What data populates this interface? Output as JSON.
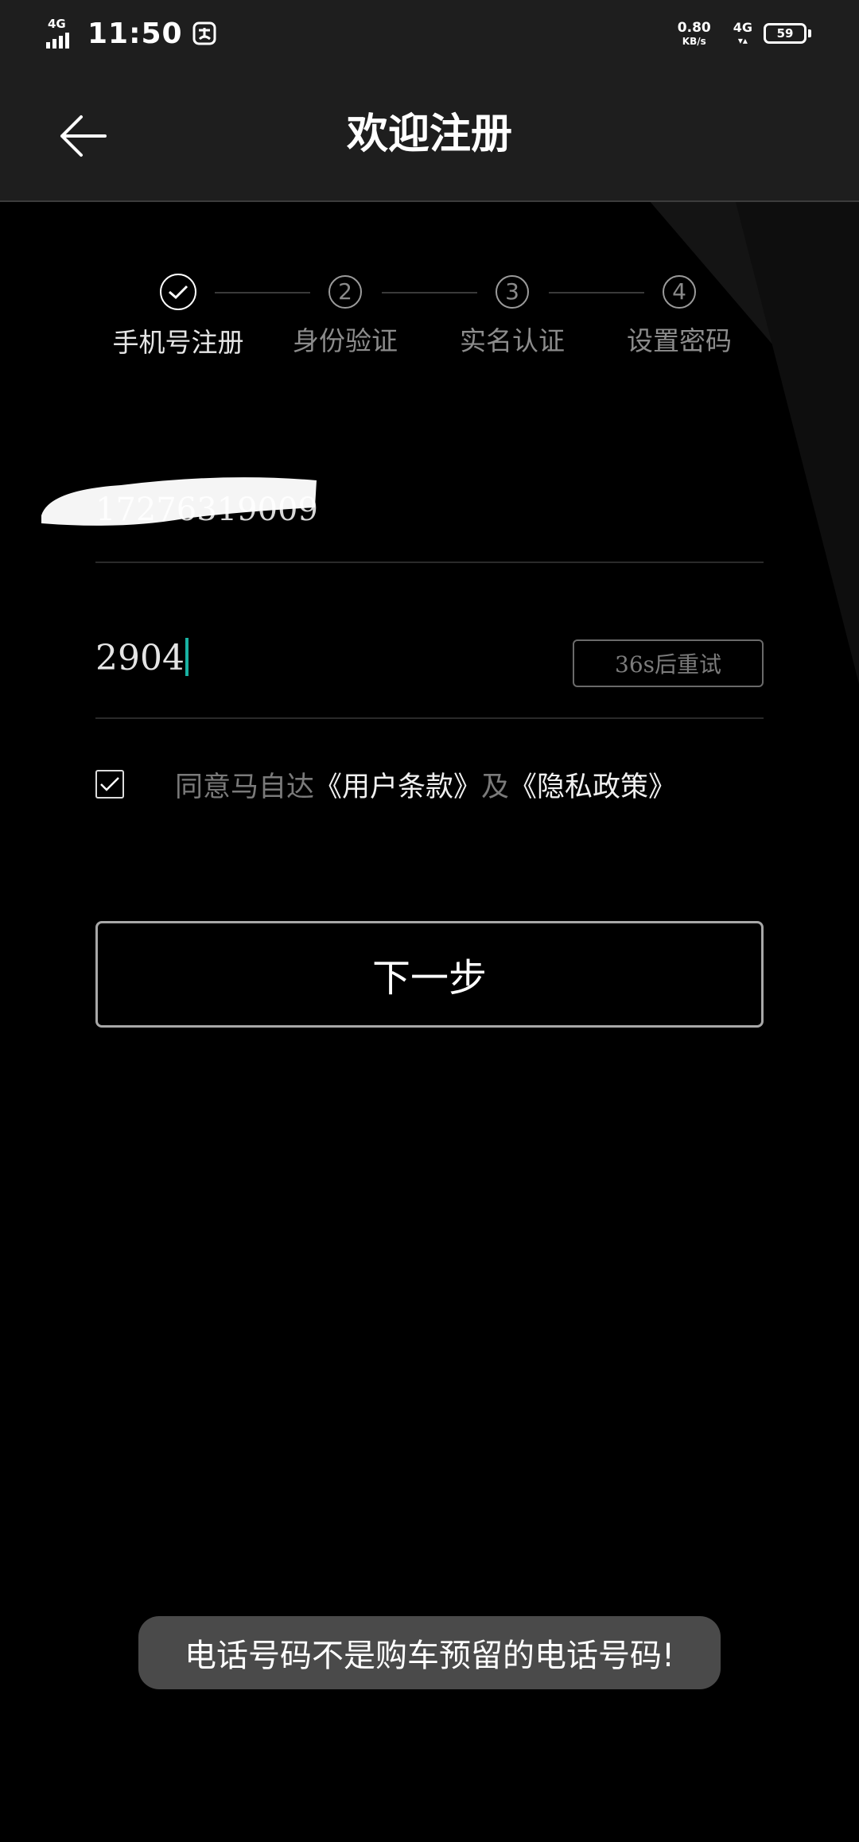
{
  "status_bar": {
    "network_type": "4G",
    "time": "11:50",
    "speed_value": "0.80",
    "speed_unit": "KB/s",
    "network_type_2": "4G",
    "battery_level": "59"
  },
  "header": {
    "title": "欢迎注册",
    "back_icon": "arrow-left-icon"
  },
  "stepper": {
    "steps": [
      {
        "number": "",
        "label": "手机号注册",
        "state": "done"
      },
      {
        "number": "2",
        "label": "身份验证",
        "state": "pending"
      },
      {
        "number": "3",
        "label": "实名认证",
        "state": "pending"
      },
      {
        "number": "4",
        "label": "设置密码",
        "state": "pending"
      }
    ]
  },
  "form": {
    "phone_value": "17276319009",
    "code_value": "2904",
    "retry_label": "36s后重试"
  },
  "agreement": {
    "checked": true,
    "prefix": "同意马自达",
    "terms_link": "《用户条款》",
    "conjunction": "及",
    "privacy_link": "《隐私政策》"
  },
  "next_button": {
    "label": "下一步"
  },
  "toast": {
    "message": "电话号码不是购车预留的电话号码!"
  },
  "colors": {
    "background": "#000000",
    "header_bg": "#1e1e1e",
    "caret": "#19b3a3",
    "toast_bg": "#4a4a4a"
  }
}
